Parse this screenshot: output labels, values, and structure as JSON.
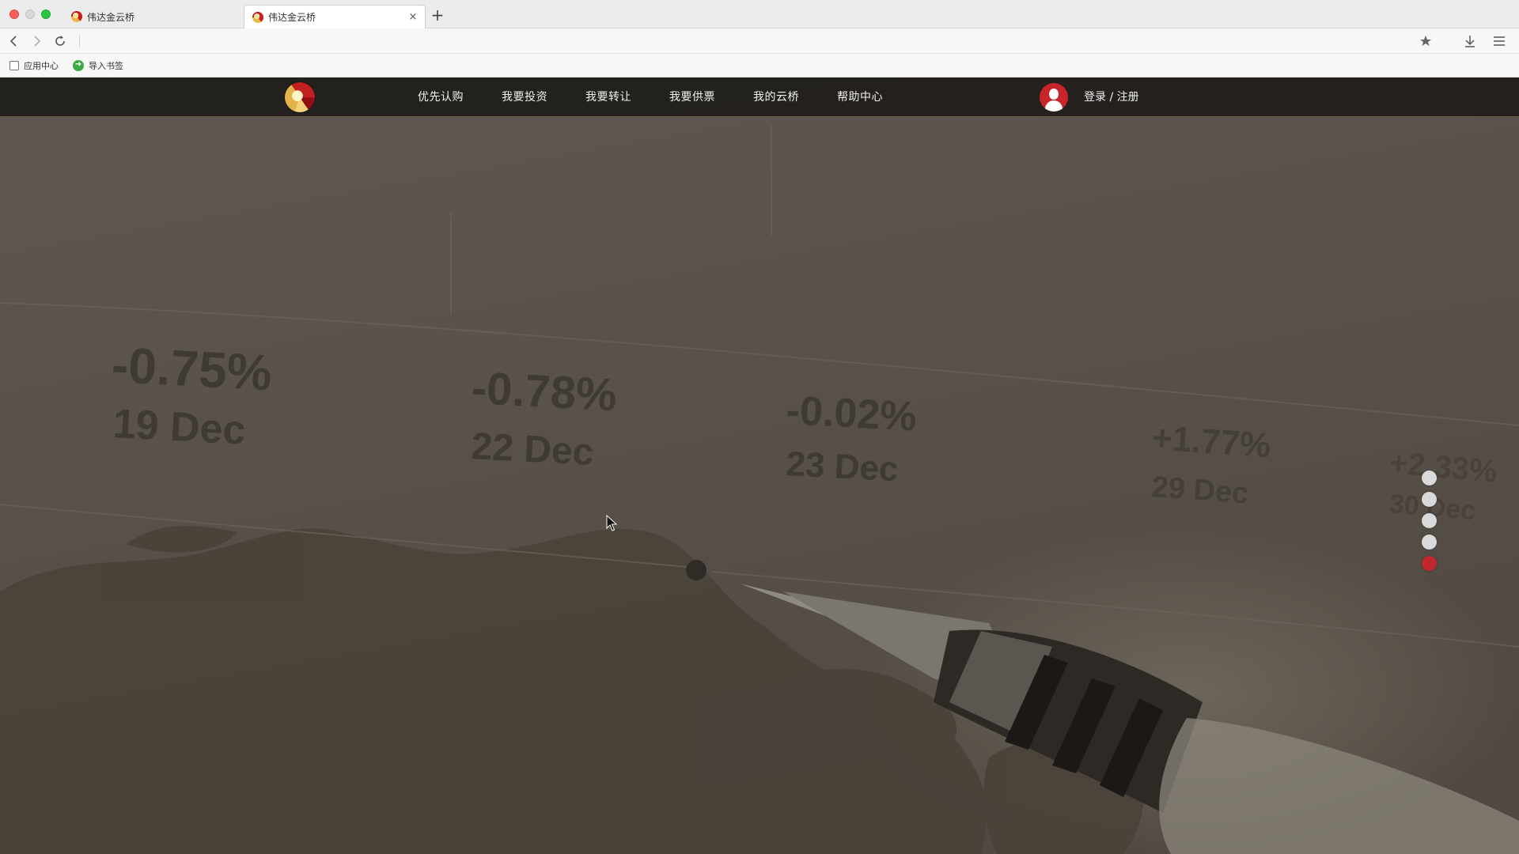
{
  "browser": {
    "tabs": [
      {
        "title": "伟达金云桥",
        "active": false
      },
      {
        "title": "伟达金云桥",
        "active": true,
        "close": "×"
      }
    ],
    "new_tab": "+",
    "bookmarks": [
      {
        "label": "应用中心",
        "icon": "apps-icon"
      },
      {
        "label": "导入书签",
        "icon": "import-bookmarks-icon"
      }
    ],
    "toolbar_icons": [
      "back-icon",
      "forward-icon",
      "reload-icon",
      "star-icon",
      "download-icon",
      "menu-icon"
    ]
  },
  "site": {
    "logo": "site-logo",
    "nav": [
      {
        "label": "优先认购"
      },
      {
        "label": "我要投资"
      },
      {
        "label": "我要转让"
      },
      {
        "label": "我要供票"
      },
      {
        "label": "我的云桥"
      },
      {
        "label": "帮助中心"
      }
    ],
    "login": "登录 / 注册",
    "colors": {
      "accent": "#c0282d",
      "nav_bg": "#1e1c1a",
      "nav_text": "#f2f2f2"
    }
  },
  "hero": {
    "figures": [
      {
        "pct": "-0.75%",
        "date": "19 Dec"
      },
      {
        "pct": "-0.78%",
        "date": "22 Dec"
      },
      {
        "pct": "-0.02%",
        "date": "23 Dec"
      },
      {
        "pct": "+1.77%",
        "date": "29 Dec"
      },
      {
        "pct": "+2.33%",
        "date": "30 Dec"
      }
    ]
  },
  "slider": {
    "count": 5,
    "active_index": 4
  }
}
